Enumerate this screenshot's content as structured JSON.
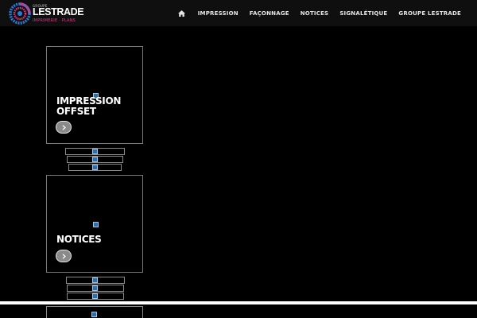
{
  "brand": {
    "small": "GROUPE",
    "name": "LESTRADE",
    "tagline": "IMPRIMERIE · PLANS"
  },
  "nav": {
    "home_icon": "home-icon",
    "items": [
      "IMPRESSION",
      "FAÇONNAGE",
      "NOTICES",
      "SIGNALÉTIQUE",
      "GROUPE LESTRADE"
    ]
  },
  "cards": [
    {
      "title_line1": "IMPRESSION",
      "title_line2": "OFFSET",
      "button_icon": "chevron-right-icon"
    },
    {
      "title_line1": "NOTICES",
      "title_line2": "",
      "button_icon": "chevron-right-icon"
    }
  ],
  "colors": {
    "background": "#000000",
    "header": "#0f0f0f",
    "brand_accent": "#d93a8a",
    "logo_ring": "#2b7bd8",
    "placeholder": "#2f6ea8"
  }
}
